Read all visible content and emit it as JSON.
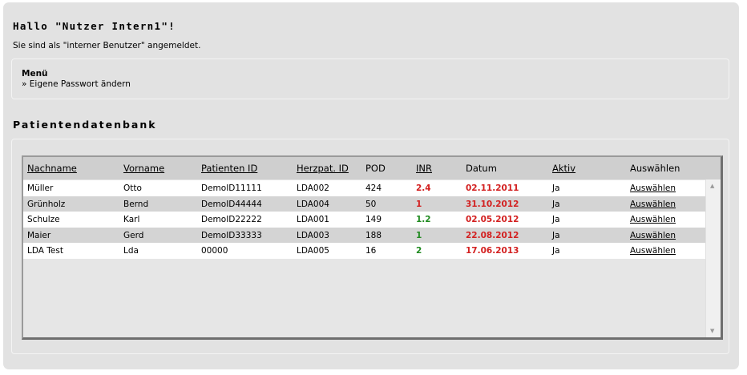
{
  "greeting": "Hallo \"Nutzer Intern1\"!",
  "login_status": "Sie sind als \"interner Benutzer\" angemeldet.",
  "menu": {
    "title": "Menü",
    "items": [
      {
        "label": "» Eigene Passwort ändern"
      }
    ]
  },
  "section_title": "Patientendatenbank",
  "table": {
    "columns": [
      {
        "label": "Nachname",
        "sortable": true
      },
      {
        "label": "Vorname",
        "sortable": true
      },
      {
        "label": "Patienten ID",
        "sortable": true
      },
      {
        "label": "Herzpat. ID",
        "sortable": true
      },
      {
        "label": "POD",
        "sortable": false
      },
      {
        "label": "INR",
        "sortable": true
      },
      {
        "label": "Datum",
        "sortable": false
      },
      {
        "label": "Aktiv",
        "sortable": true
      },
      {
        "label": "Auswählen",
        "sortable": false
      }
    ],
    "rows": [
      {
        "nachname": "Müller",
        "vorname": "Otto",
        "patienten_id": "DemoID11111",
        "herzpat_id": "LDA002",
        "pod": "424",
        "inr": "2.4",
        "inr_status": "red",
        "datum": "02.11.2011",
        "aktiv": "Ja",
        "select_label": "Auswählen"
      },
      {
        "nachname": "Grünholz",
        "vorname": "Bernd",
        "patienten_id": "DemoID44444",
        "herzpat_id": "LDA004",
        "pod": "50",
        "inr": "1",
        "inr_status": "red",
        "datum": "31.10.2012",
        "aktiv": "Ja",
        "select_label": "Auswählen"
      },
      {
        "nachname": "Schulze",
        "vorname": "Karl",
        "patienten_id": "DemoID22222",
        "herzpat_id": "LDA001",
        "pod": "149",
        "inr": "1.2",
        "inr_status": "green",
        "datum": "02.05.2012",
        "aktiv": "Ja",
        "select_label": "Auswählen"
      },
      {
        "nachname": "Maier",
        "vorname": "Gerd",
        "patienten_id": "DemoID33333",
        "herzpat_id": "LDA003",
        "pod": "188",
        "inr": "1",
        "inr_status": "green",
        "datum": "22.08.2012",
        "aktiv": "Ja",
        "select_label": "Auswählen"
      },
      {
        "nachname": "LDA Test",
        "vorname": "Lda",
        "patienten_id": "00000",
        "herzpat_id": "LDA005",
        "pod": "16",
        "inr": "2",
        "inr_status": "green",
        "datum": "17.06.2013",
        "aktiv": "Ja",
        "select_label": "Auswählen"
      }
    ]
  },
  "colors": {
    "panel_bg": "#e2e2e2",
    "header_bg": "#cfcfcf",
    "row_alt_bg": "#d4d4d4",
    "inr_red": "#d32020",
    "inr_green": "#1f8a1f",
    "date_red": "#d32020"
  },
  "icons": {
    "scroll_up": "triangle-up",
    "scroll_down": "triangle-down"
  }
}
